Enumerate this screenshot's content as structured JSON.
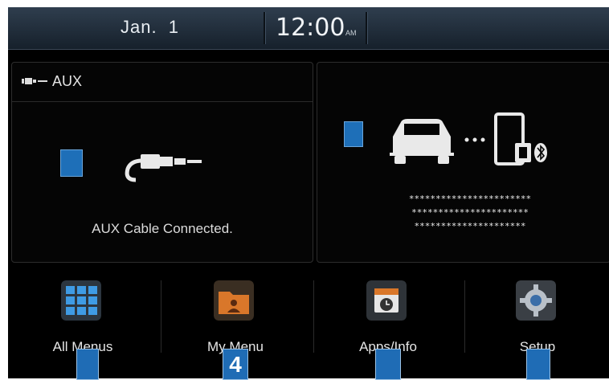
{
  "status_bar": {
    "date": "Jan.  1",
    "time": "12:00",
    "ampm": "AM"
  },
  "aux_panel": {
    "title": "AUX",
    "message": "AUX Cable Connected."
  },
  "bluetooth_panel": {
    "masked_lines": [
      "***********************",
      "**********************",
      "*********************"
    ]
  },
  "menu": [
    {
      "label": "All Menus",
      "icon": "grid-icon"
    },
    {
      "label": "My Menu",
      "icon": "folder-icon"
    },
    {
      "label": "Apps/Info",
      "icon": "clock-calendar-icon"
    },
    {
      "label": "Setup",
      "icon": "gear-icon"
    }
  ],
  "callouts": {
    "badge_4": "4"
  },
  "colors": {
    "accent": "#1f6cb5",
    "statusbar": "#1c2833",
    "background": "#000000"
  }
}
